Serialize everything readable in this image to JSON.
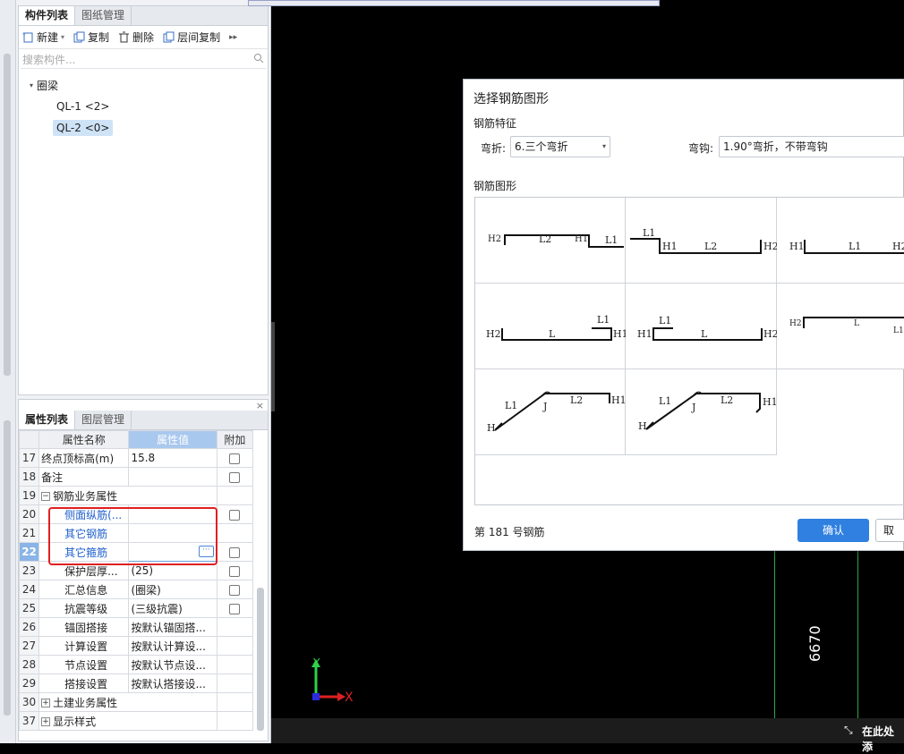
{
  "component_panel": {
    "tabs": [
      "构件列表",
      "图纸管理"
    ],
    "toolbar": {
      "new": "新建",
      "copy": "复制",
      "delete": "删除",
      "floor_copy": "层间复制"
    },
    "search_placeholder": "搜索构件...",
    "tree": {
      "group": "圈梁",
      "items": [
        "QL-1 <2>",
        "QL-2 <0>"
      ]
    }
  },
  "property_panel": {
    "tabs": [
      "属性列表",
      "图层管理"
    ],
    "headers": {
      "name": "属性名称",
      "value": "属性值",
      "extra": "附加"
    },
    "rows": [
      {
        "num": "17",
        "name": "终点顶标高(m)",
        "value": "15.8"
      },
      {
        "num": "18",
        "name": "备注",
        "value": ""
      },
      {
        "num": "19",
        "name": "钢筋业务属性",
        "value": ""
      },
      {
        "num": "20",
        "name": "侧面纵筋(...",
        "value": ""
      },
      {
        "num": "21",
        "name": "其它钢筋",
        "value": ""
      },
      {
        "num": "22",
        "name": "其它箍筋",
        "value": ""
      },
      {
        "num": "23",
        "name": "保护层厚...",
        "value": "(25)"
      },
      {
        "num": "24",
        "name": "汇总信息",
        "value": "(圈梁)"
      },
      {
        "num": "25",
        "name": "抗震等级",
        "value": "(三级抗震)"
      },
      {
        "num": "26",
        "name": "锚固搭接",
        "value": "按默认锚固搭..."
      },
      {
        "num": "27",
        "name": "计算设置",
        "value": "按默认计算设..."
      },
      {
        "num": "28",
        "name": "节点设置",
        "value": "按默认节点设..."
      },
      {
        "num": "29",
        "name": "搭接设置",
        "value": "按默认搭接设..."
      },
      {
        "num": "30",
        "name": "土建业务属性",
        "value": ""
      },
      {
        "num": "37",
        "name": "显示样式",
        "value": ""
      }
    ]
  },
  "dialog": {
    "title": "选择钢筋图形",
    "feature_label": "钢筋特征",
    "bend_label": "弯折:",
    "bend_value": "6.三个弯折",
    "hook_label": "弯钩:",
    "hook_value": "1.90°弯折，不带弯钩",
    "shape_label": "钢筋图形",
    "shapes": [
      [
        "H2",
        "L2",
        "H1",
        "L1"
      ],
      [
        "L1",
        "H1",
        "L2",
        "H2"
      ],
      [
        "H1",
        "L1",
        "H2"
      ],
      [
        "H2",
        "L",
        "L1",
        "H1"
      ],
      [
        "H1",
        "L1",
        "L",
        "H2"
      ],
      [
        "H2",
        "L",
        "L1"
      ],
      [
        "L1",
        "J",
        "L2",
        "H1",
        "H"
      ],
      [
        "L1",
        "J",
        "L2",
        "H1",
        "H"
      ]
    ],
    "status": "第 181 号钢筋",
    "ok": "确认",
    "cancel": "取"
  },
  "canvas": {
    "dimension": "6670",
    "axis_x": "X",
    "axis_y": "Y",
    "hint": "在此处添"
  }
}
